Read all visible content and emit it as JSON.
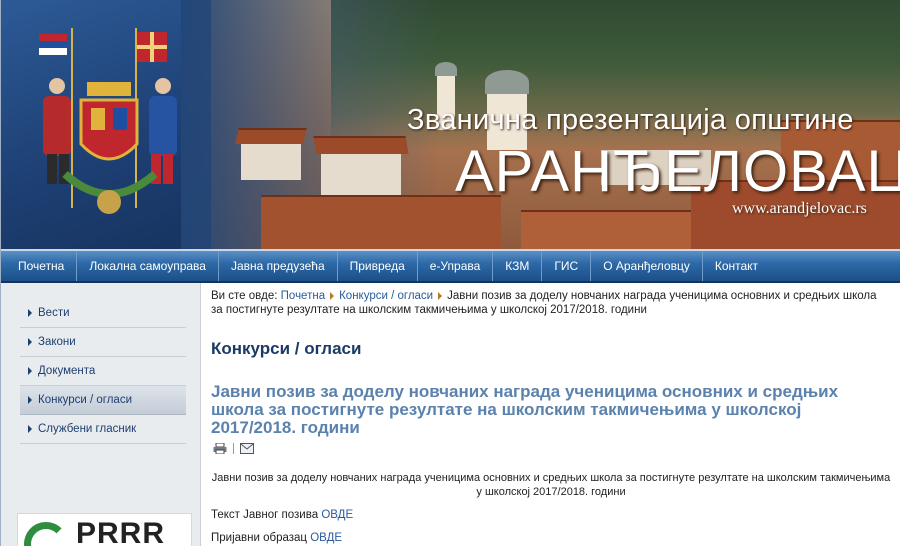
{
  "header": {
    "title_line1": "Званична презентација општине",
    "title_line2": "АРАНЂЕЛОВАЦ",
    "url": "www.arandjelovac.rs",
    "logo": "coat-of-arms-icon"
  },
  "nav": {
    "items": [
      "Почетна",
      "Локална самоуправа",
      "Јавна предузећа",
      "Привреда",
      "е-Управа",
      "КЗМ",
      "ГИС",
      "О Аранђеловцу",
      "Контакт"
    ]
  },
  "sidebar": {
    "items": [
      "Вести",
      "Закони",
      "Документа",
      "Конкурси / огласи",
      "Службени гласник"
    ],
    "active_index": 3,
    "banner_text": "PRRR"
  },
  "breadcrumb": {
    "prefix": "Ви сте овде:",
    "home": "Почетна",
    "section": "Конкурси / огласи",
    "current": "Јавни позив за доделу новчаних награда ученицима основних и средњих школа за постигнуте резултате на школским такмичењима у школској 2017/2018. години"
  },
  "content": {
    "section_title": "Конкурси / огласи",
    "article_title": "Јавни позив за доделу новчаних награда ученицима основних и средњих школа за постигнуте резултате на школским такмичењима у школској 2017/2018. години",
    "lead": "Јавни позив за доделу новчаних награда ученицима основних и средњих школа за постигнуте резултате на школским такмичењима у школској 2017/2018. години",
    "text_label": "Текст Јавног позива",
    "text_link": "ОВДЕ",
    "form_label": "Пријавни образац",
    "form_link": "ОВДЕ"
  },
  "icons": {
    "print": "print-icon",
    "email": "email-icon"
  },
  "colors": {
    "nav": "#2e6aa8",
    "title": "#1b3b66",
    "article_title": "#5b82ad",
    "link": "#2a5c9a"
  }
}
